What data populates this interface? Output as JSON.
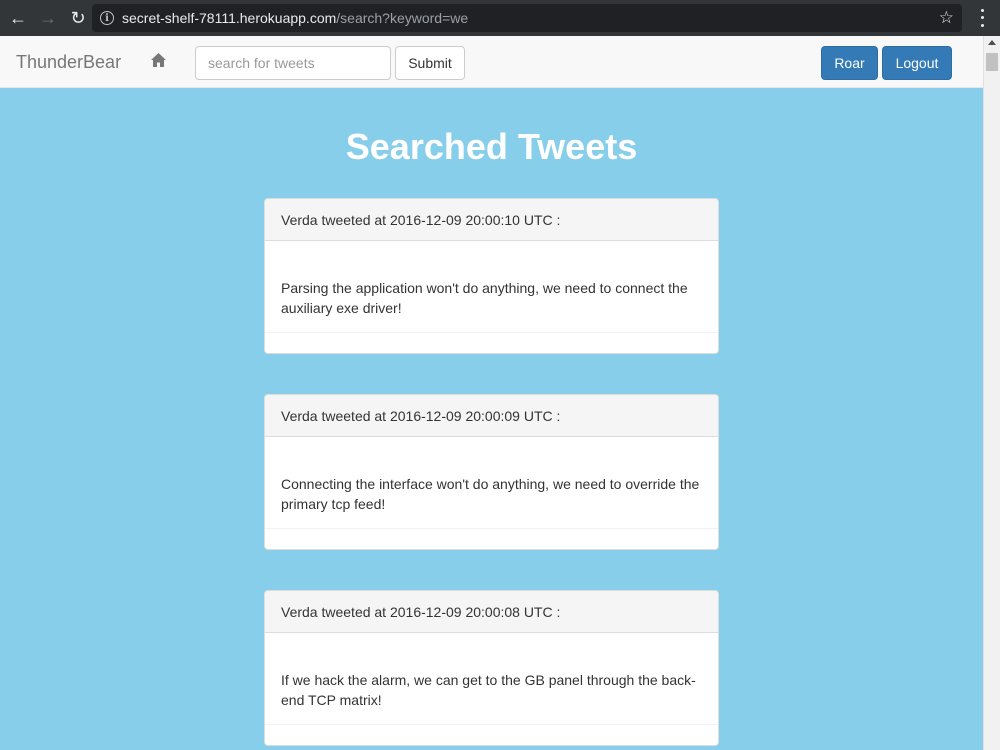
{
  "browser": {
    "url_host": "secret-shelf-78111.herokuapp.com",
    "url_path": "/search?keyword=we",
    "icons": {
      "back": "arrow-left-icon",
      "forward": "arrow-right-icon",
      "reload": "reload-icon",
      "info": "info-icon",
      "bookmark": "star-icon",
      "menu": "more-vert-icon"
    }
  },
  "navbar": {
    "brand": "ThunderBear",
    "home_icon": "home-icon",
    "search_placeholder": "search for tweets",
    "search_value": "",
    "submit_label": "Submit",
    "roar_label": "Roar",
    "logout_label": "Logout"
  },
  "page": {
    "title": "Searched Tweets"
  },
  "tweets": [
    {
      "heading": "Verda tweeted at 2016-12-09 20:00:10 UTC :",
      "body": "Parsing the application won't do anything, we need to connect the auxiliary exe driver!"
    },
    {
      "heading": "Verda tweeted at 2016-12-09 20:00:09 UTC :",
      "body": "Connecting the interface won't do anything, we need to override the primary tcp feed!"
    },
    {
      "heading": "Verda tweeted at 2016-12-09 20:00:08 UTC :",
      "body": "If we hack the alarm, we can get to the GB panel through the back-end TCP matrix!"
    }
  ],
  "colors": {
    "background": "#87ceeb",
    "primary_button": "#337ab7",
    "navbar": "#f8f8f8"
  }
}
